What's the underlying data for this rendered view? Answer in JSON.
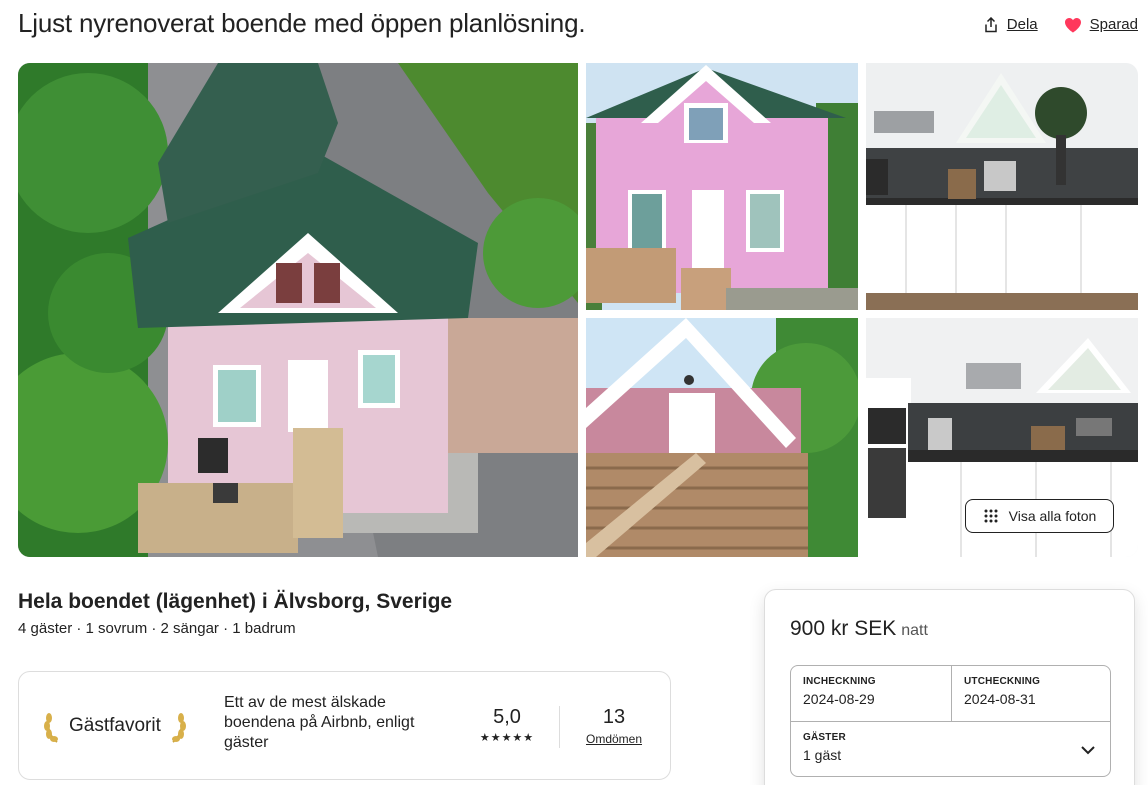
{
  "page": {
    "title": "Ljust nyrenoverat boende med öppen planlösning."
  },
  "actions": {
    "share_label": "Dela",
    "save_label": "Sparad",
    "heart_color": "#FF385C"
  },
  "gallery": {
    "show_all_label": "Visa alla foton",
    "photos": [
      "house-aerial",
      "house-front",
      "kitchen",
      "house-side",
      "kitchen-corner"
    ]
  },
  "listing": {
    "title": "Hela boendet (lägenhet) i Älvsborg, Sverige",
    "subtitle": "4 gäster · 1 sovrum · 2 sängar · 1 badrum"
  },
  "guest_favorite": {
    "badge_label": "Gästfavorit",
    "description": "Ett av de mest älskade boendena på Airbnb, enligt gäster",
    "rating": "5,0",
    "stars": "★★★★★",
    "reviews_count": "13",
    "reviews_label": "Omdömen"
  },
  "booking": {
    "price": "900 kr SEK",
    "per": "natt",
    "checkin_label": "INCHECKNING",
    "checkin_value": "2024-08-29",
    "checkout_label": "UTCHECKNING",
    "checkout_value": "2024-08-31",
    "guests_label": "GÄSTER",
    "guests_value": "1 gäst"
  }
}
